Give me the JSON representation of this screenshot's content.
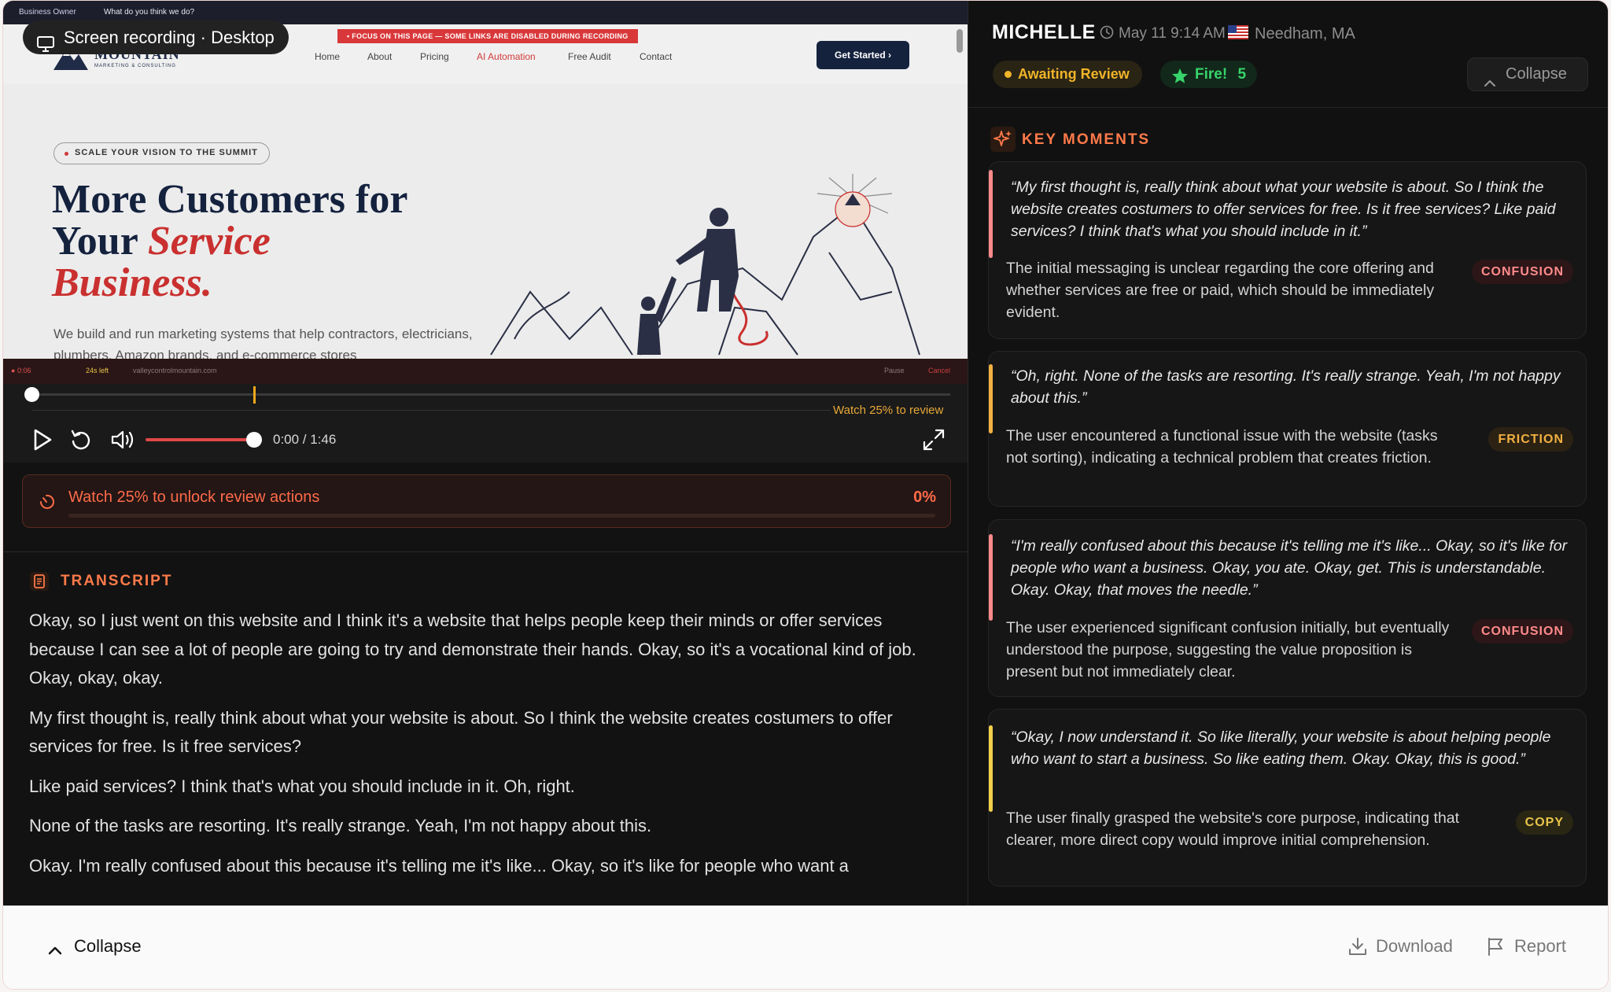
{
  "recording": {
    "chip_label": "Screen recording · Desktop",
    "website": {
      "topbar_badge": "Business Owner",
      "topbar_question": "What do you think we do?",
      "focus_banner": "• FOCUS ON THIS PAGE — SOME LINKS ARE DISABLED DURING RECORDING",
      "logo_name": "MOUNTAIN",
      "logo_sub": "MARKETING & CONSULTING",
      "nav": [
        "Home",
        "About",
        "Pricing",
        "AI Automation",
        "Free Audit",
        "Contact"
      ],
      "nav_active": "AI Automation",
      "cta": "Get Started ›",
      "pill": "SCALE YOUR VISION TO THE SUMMIT",
      "hero_line1": "More Customers for",
      "hero_line2a": "Your ",
      "hero_line2b": "Service",
      "hero_line3": "Business.",
      "subtitle": "We build and run marketing systems that help contractors, electricians, plumbers, Amazon brands, and e-commerce stores"
    },
    "rec_bar": {
      "timer": "0:06",
      "left": "24s left",
      "url": "valleycontrolmountain.com",
      "pause": "Pause",
      "cancel": "Cancel"
    },
    "player": {
      "watch_hint": "Watch 25% to review",
      "time": "0:00 / 1:46",
      "progress": 0.0,
      "review_marker": 0.25,
      "volume": 0.8
    },
    "unlock": {
      "label": "Watch 25% to unlock review actions",
      "percent_label": "0%",
      "percent": 0
    }
  },
  "transcript": {
    "title": "TRANSCRIPT",
    "paragraphs": [
      "Okay, so I just went on this website and I think it's a website that helps people keep their minds or offer services because I can see a lot of people are going to try and demonstrate their hands. Okay, so it's a vocational kind of job. Okay, okay, okay.",
      "My first thought is, really think about what your website is about. So I think the website creates costumers to offer services for free. Is it free services?",
      "Like paid services? I think that's what you should include in it. Oh, right.",
      "None of the tasks are resorting. It's really strange. Yeah, I'm not happy about this.",
      "Okay. I'm really confused about this because it's telling me it's like... Okay, so it's like for people who want a"
    ]
  },
  "reviewer": {
    "name": "MICHELLE",
    "time": "May 11 9:14 AM",
    "location": "Needham, MA",
    "status": "Awaiting Review",
    "fire_label": "Fire!",
    "fire_count": "5",
    "collapse": "Collapse"
  },
  "key_moments": {
    "title": "KEY MOMENTS",
    "items": [
      {
        "quote": "“My first thought is, really think about what your website is about. So I think the website creates costumers to offer services for free. Is it free services? Like paid services? I think that's what you should include in it.”",
        "description": "The initial messaging is unclear regarding the core offering and whether services are free or paid, which should be immediately evident.",
        "tag": "CONFUSION",
        "accent": "#ff8a8a"
      },
      {
        "quote": "“Oh, right. None of the tasks are resorting. It's really strange. Yeah, I'm not happy about this.”",
        "description": "The user encountered a functional issue with the website (tasks not sorting), indicating a technical problem that creates friction.",
        "tag": "FRICTION",
        "accent": "#f2b040"
      },
      {
        "quote": "“I'm really confused about this because it's telling me it's like... Okay, so it's like for people who want a business. Okay, you ate. Okay, get. This is understandable. Okay. Okay, that moves the needle.”",
        "description": "The user experienced significant confusion initially, but eventually understood the purpose, suggesting the value proposition is present but not immediately clear.",
        "tag": "CONFUSION",
        "accent": "#ff8a8a"
      },
      {
        "quote": "“Okay, I now understand it. So like literally, your website is about helping people who want to start a business. So like eating them. Okay. Okay, this is good.”",
        "description": "The user finally grasped the website's core purpose, indicating that clearer, more direct copy would improve initial comprehension.",
        "tag": "COPY",
        "accent": "#f2d04a"
      }
    ]
  },
  "footer": {
    "collapse": "Collapse",
    "download": "Download",
    "report": "Report"
  },
  "colors": {
    "accent_orange": "#ff7a4a",
    "status_yellow": "#f0b429",
    "fire_green": "#37d36b",
    "volume_red": "#e04848"
  }
}
